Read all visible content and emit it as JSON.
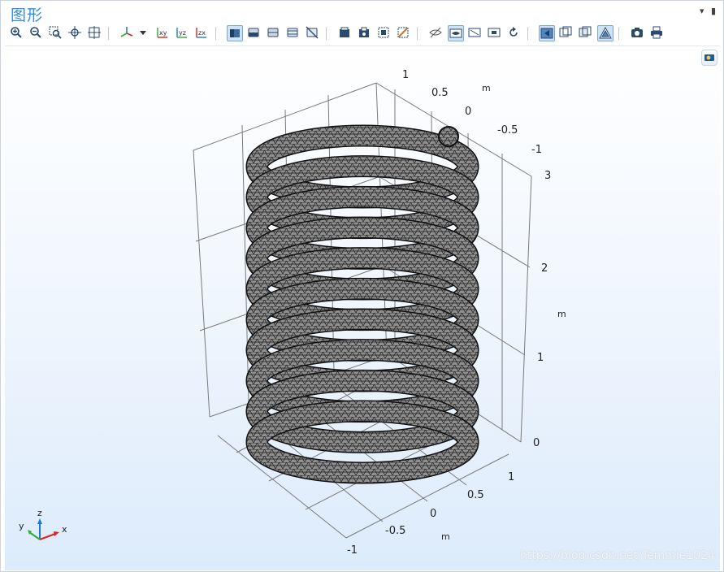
{
  "window": {
    "title": "图形"
  },
  "viewport": {
    "axis_ticks": {
      "y_top": [
        "1",
        "0.5",
        "0",
        "-0.5",
        "-1"
      ],
      "z_right": [
        "3",
        "2",
        "1",
        "0"
      ],
      "x_bottom": [
        "1",
        "0.5",
        "0",
        "-0.5",
        "-1"
      ]
    },
    "units": {
      "y_top": "m",
      "z_right": "m",
      "x_bottom": "m"
    },
    "triad": {
      "x": "x",
      "y": "y",
      "z": "z"
    }
  },
  "watermark": "https://blog.csdn.net/Temmie1024",
  "colors": {
    "accent": "#2f8de4",
    "mesh_fill": "#8c8c8c",
    "mesh_line": "#111111"
  },
  "toolbar_icons": [
    "zoom-in-icon",
    "zoom-out-icon",
    "zoom-box-icon",
    "zoom-extents-icon",
    "zoom-selected-icon",
    "view-triad-icon",
    "view-dropdown-icon",
    "view-xy-icon",
    "view-yz-icon",
    "view-zx-icon",
    "scene-light-icon",
    "transparency-icon",
    "clip-icon",
    "wireframe-icon",
    "hide-icon",
    "select-domains-icon",
    "select-boundaries-icon",
    "select-box-icon",
    "clear-selection-icon",
    "hide-select-icon",
    "show-grid-icon",
    "show-axes-icon",
    "show-labels-icon",
    "reset-icon",
    "render-solid-icon",
    "render-wire-icon",
    "render-edges-icon",
    "render-mesh-icon",
    "camera-icon",
    "print-icon"
  ]
}
